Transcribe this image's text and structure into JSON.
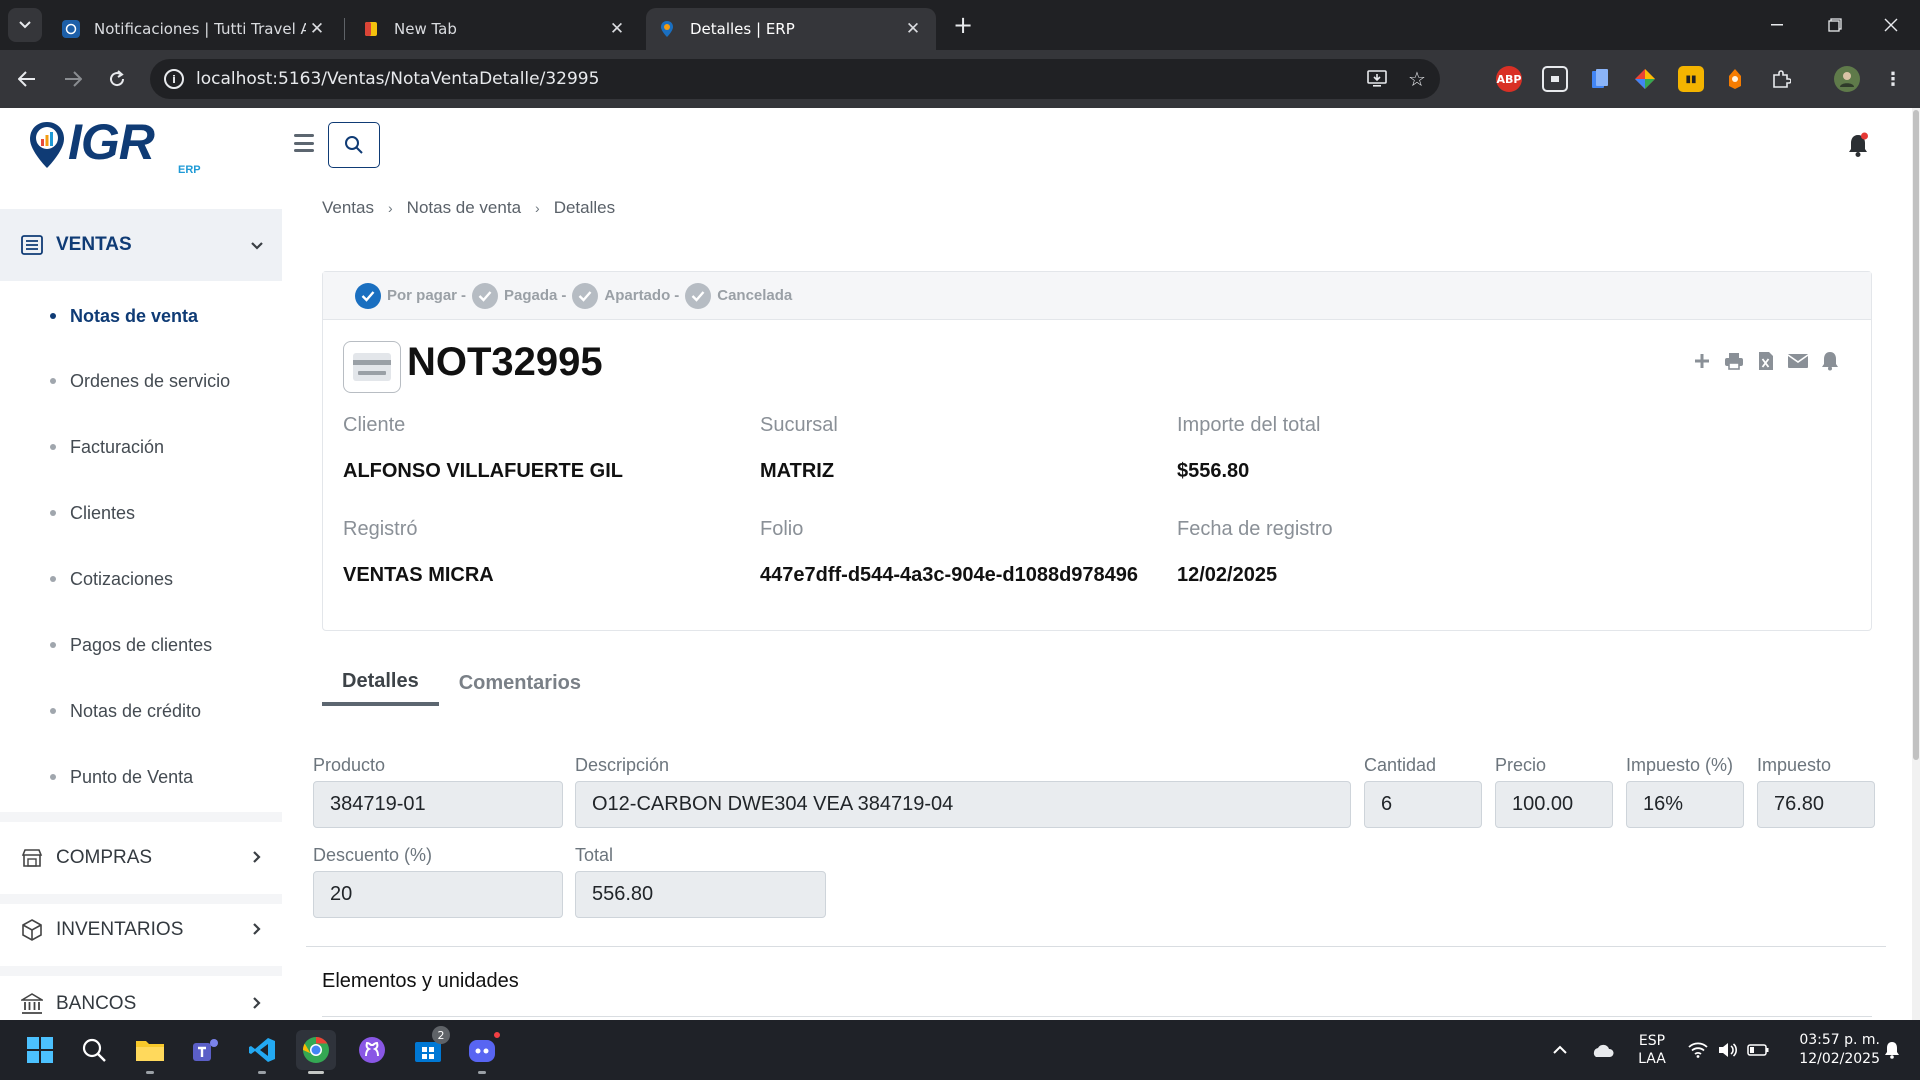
{
  "browser": {
    "tabs": [
      {
        "title": "Notificaciones | Tutti Travel Age",
        "active": false
      },
      {
        "title": "New Tab",
        "active": false
      },
      {
        "title": "Detalles | ERP",
        "active": true
      }
    ],
    "url": "localhost:5163/Ventas/NotaVentaDetalle/32995",
    "extensions": [
      "ABP",
      "screen-icon",
      "docs-icon",
      "color-icon",
      "ext-icon",
      "fox-icon",
      "puzzle-icon",
      "avatar"
    ]
  },
  "app": {
    "logo_text": "IGR",
    "logo_sub": "ERP",
    "accent": "#0f3b75"
  },
  "sidebar": {
    "sections": [
      {
        "label": "VENTAS",
        "icon": "list-icon",
        "open": true
      },
      {
        "label": "COMPRAS",
        "icon": "store-icon",
        "open": false
      },
      {
        "label": "INVENTARIOS",
        "icon": "box-icon",
        "open": false
      },
      {
        "label": "BANCOS",
        "icon": "bank-icon",
        "open": false
      }
    ],
    "ventas_items": [
      {
        "label": "Notas de venta",
        "active": true
      },
      {
        "label": "Ordenes de servicio",
        "active": false
      },
      {
        "label": "Facturación",
        "active": false
      },
      {
        "label": "Clientes",
        "active": false
      },
      {
        "label": "Cotizaciones",
        "active": false
      },
      {
        "label": "Pagos de clientes",
        "active": false
      },
      {
        "label": "Notas de crédito",
        "active": false
      },
      {
        "label": "Punto de Venta",
        "active": false
      }
    ]
  },
  "breadcrumb": [
    "Ventas",
    "Notas de venta",
    "Detalles"
  ],
  "status_steps": [
    {
      "label": "Por pagar",
      "done": true
    },
    {
      "label": "Pagada",
      "done": false
    },
    {
      "label": "Apartado",
      "done": false
    },
    {
      "label": "Cancelada",
      "done": false
    }
  ],
  "document": {
    "title": "NOT32995",
    "fields": {
      "cliente": {
        "label": "Cliente",
        "value": "ALFONSO VILLAFUERTE GIL"
      },
      "sucursal": {
        "label": "Sucursal",
        "value": "MATRIZ"
      },
      "importe": {
        "label": "Importe del total",
        "value": "$556.80"
      },
      "registro": {
        "label": "Registró",
        "value": "VENTAS MICRA"
      },
      "folio": {
        "label": "Folio",
        "value": "447e7dff-d544-4a3c-904e-d1088d978496"
      },
      "fecha": {
        "label": "Fecha de registro",
        "value": "12/02/2025"
      }
    },
    "actions": [
      "plus-icon",
      "print-icon",
      "excel-icon",
      "mail-icon",
      "bell-icon"
    ]
  },
  "tabs": [
    {
      "label": "Detalles",
      "active": true
    },
    {
      "label": "Comentarios",
      "active": false
    }
  ],
  "detail": {
    "producto": {
      "label": "Producto",
      "value": "384719-01"
    },
    "descripcion": {
      "label": "Descripción",
      "value": "O12-CARBON DWE304 VEA 384719-04"
    },
    "cantidad": {
      "label": "Cantidad",
      "value": "6"
    },
    "precio": {
      "label": "Precio",
      "value": "100.00"
    },
    "impuesto_pct": {
      "label": "Impuesto (%)",
      "value": "16%"
    },
    "impuesto": {
      "label": "Impuesto",
      "value": "76.80"
    },
    "descuento": {
      "label": "Descuento (%)",
      "value": "20"
    },
    "total": {
      "label": "Total",
      "value": "556.80"
    }
  },
  "elements_title": "Elementos y unidades",
  "taskbar": {
    "apps": [
      "windows-start-icon",
      "search-icon",
      "file-explorer-icon",
      "teams-icon",
      "vscode-icon",
      "chrome-icon",
      "github-desktop-icon",
      "store-icon",
      "discord-icon"
    ],
    "store_badge": "2",
    "lang_top": "ESP",
    "lang_bottom": "LAA",
    "time": "03:57 p. m.",
    "date": "12/02/2025"
  }
}
